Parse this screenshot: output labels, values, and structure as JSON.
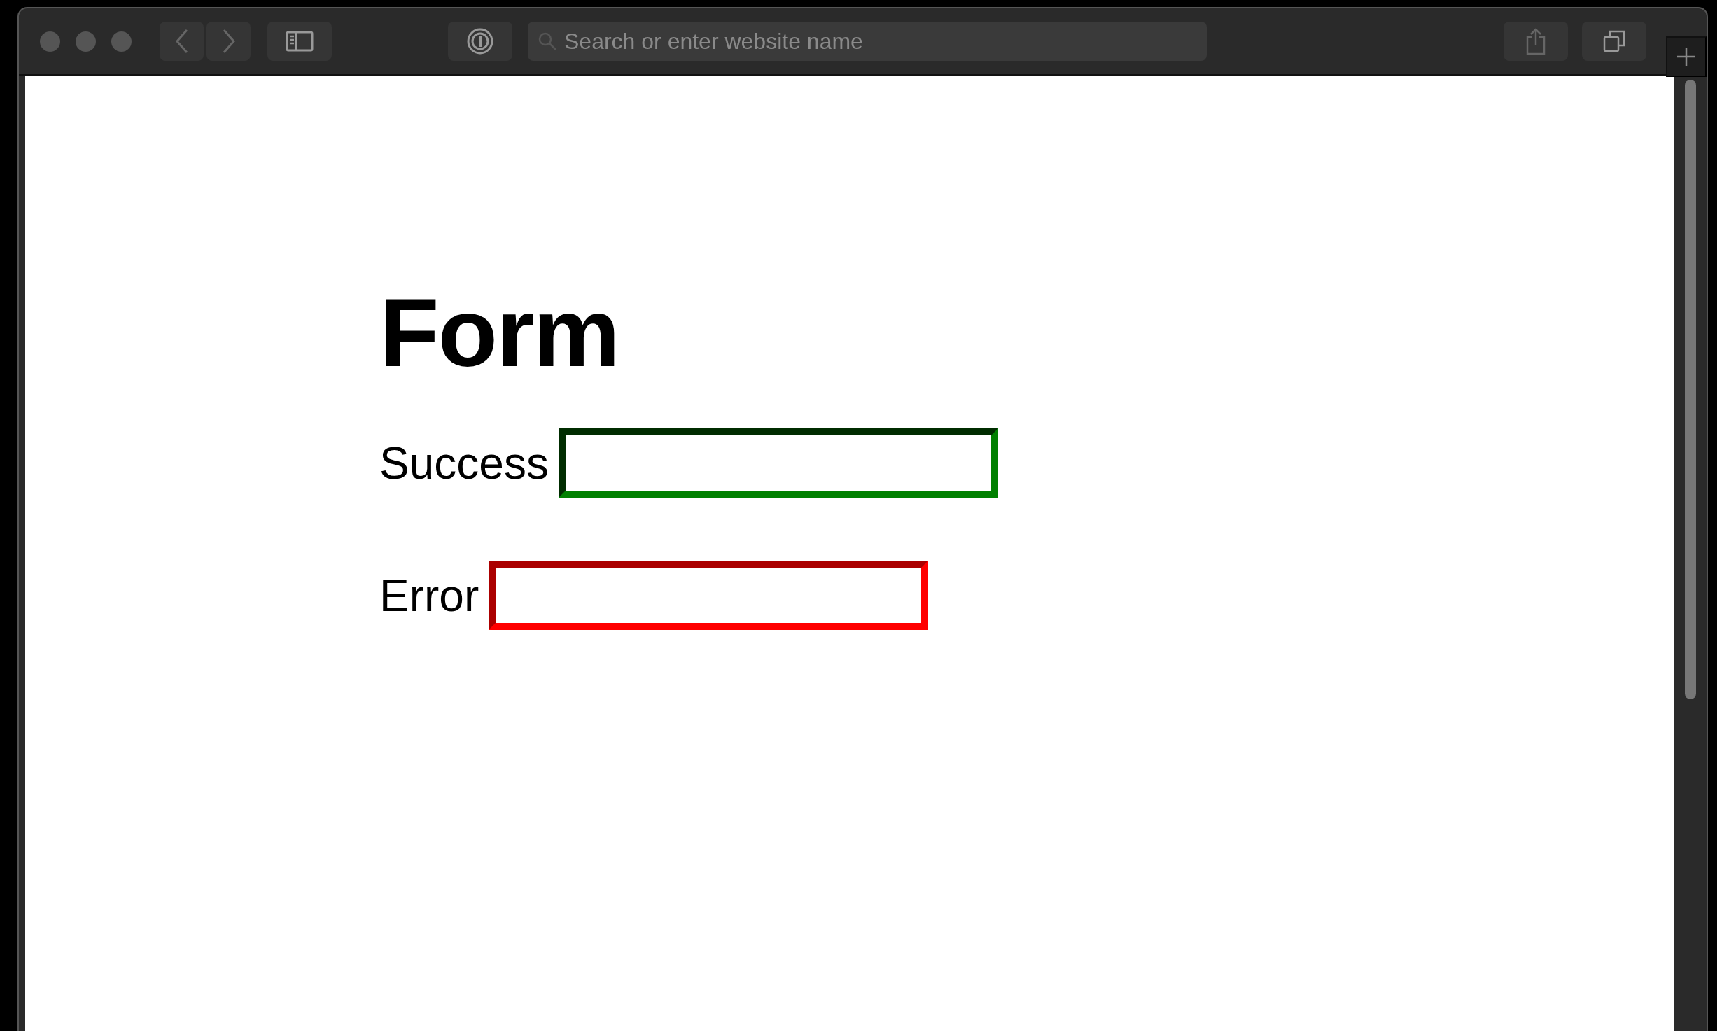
{
  "browser": {
    "address_placeholder": "Search or enter website name"
  },
  "page": {
    "heading": "Form",
    "fields": [
      {
        "label": "Success",
        "color": "#008000"
      },
      {
        "label": "Error",
        "color": "#ff0000"
      }
    ]
  }
}
